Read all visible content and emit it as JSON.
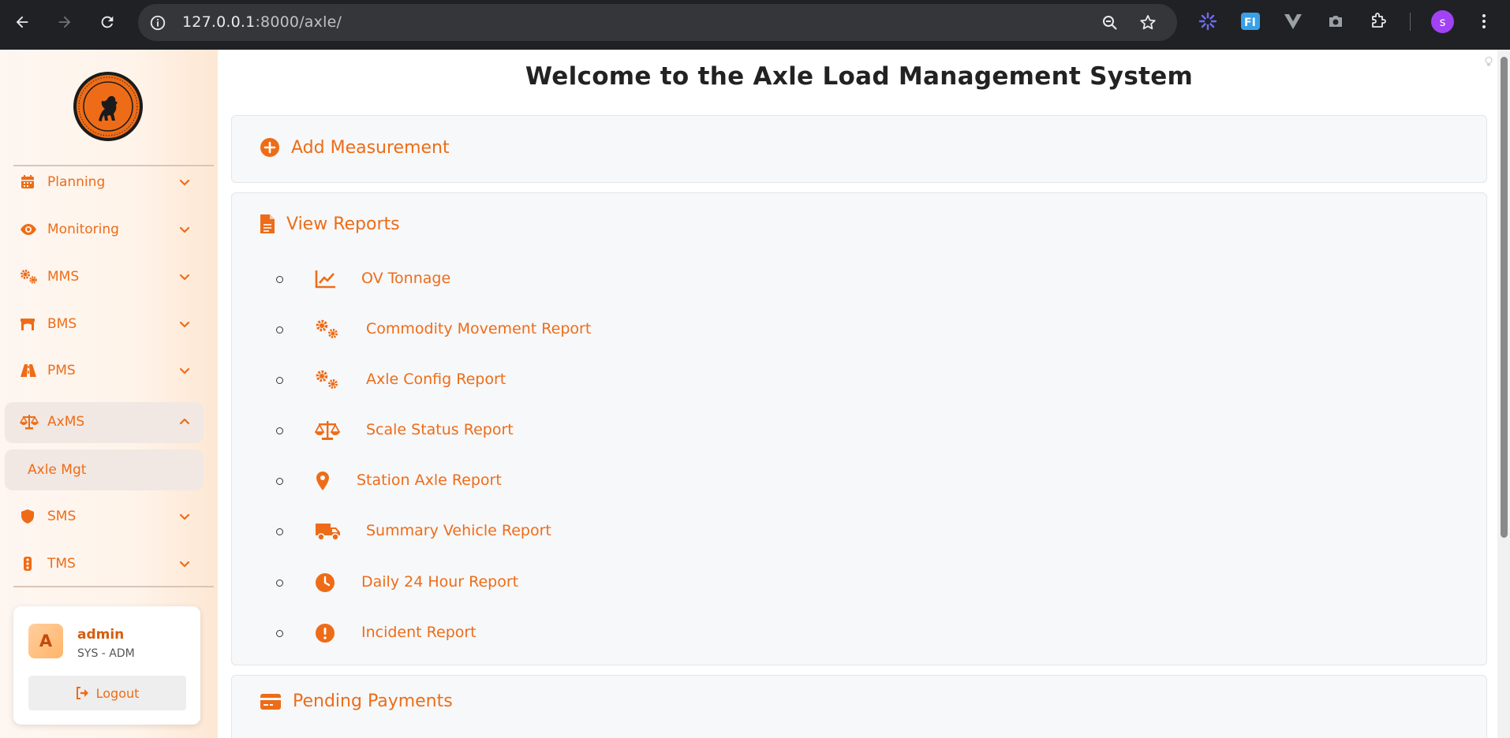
{
  "browser": {
    "url_host": "127.0.0.1",
    "url_path": ":8000/axle/",
    "profile_initial": "s"
  },
  "sidebar": {
    "items": [
      {
        "label": "Planning",
        "icon": "calendar-icon"
      },
      {
        "label": "Monitoring",
        "icon": "eye-icon"
      },
      {
        "label": "MMS",
        "icon": "cogs-icon"
      },
      {
        "label": "BMS",
        "icon": "bridge-icon"
      },
      {
        "label": "PMS",
        "icon": "road-icon"
      },
      {
        "label": "AxMS",
        "icon": "scale-icon",
        "expanded": true
      },
      {
        "label": "SMS",
        "icon": "shield-icon"
      },
      {
        "label": "TMS",
        "icon": "traffic-light-icon"
      }
    ],
    "submenu": {
      "label": "Axle Mgt"
    },
    "user": {
      "initial": "A",
      "name": "admin",
      "role": "SYS - ADM",
      "logout_label": "Logout"
    }
  },
  "main": {
    "title": "Welcome to the Axle Load Management System",
    "add_measurement": "Add Measurement",
    "view_reports": "View Reports",
    "reports": [
      {
        "label": "OV Tonnage",
        "icon": "chart-line-icon"
      },
      {
        "label": "Commodity Movement Report",
        "icon": "cogs-icon"
      },
      {
        "label": "Axle Config Report",
        "icon": "cogs-icon"
      },
      {
        "label": "Scale Status Report",
        "icon": "scale-icon"
      },
      {
        "label": "Station Axle Report",
        "icon": "map-marker-icon"
      },
      {
        "label": "Summary Vehicle Report",
        "icon": "truck-icon"
      },
      {
        "label": "Daily 24 Hour Report",
        "icon": "clock-icon"
      },
      {
        "label": "Incident Report",
        "icon": "exclamation-circle-icon"
      }
    ],
    "pending_payments": "Pending Payments"
  },
  "colors": {
    "accent": "#ee6c17",
    "chrome": "#202124",
    "omnibox": "#35363a"
  }
}
